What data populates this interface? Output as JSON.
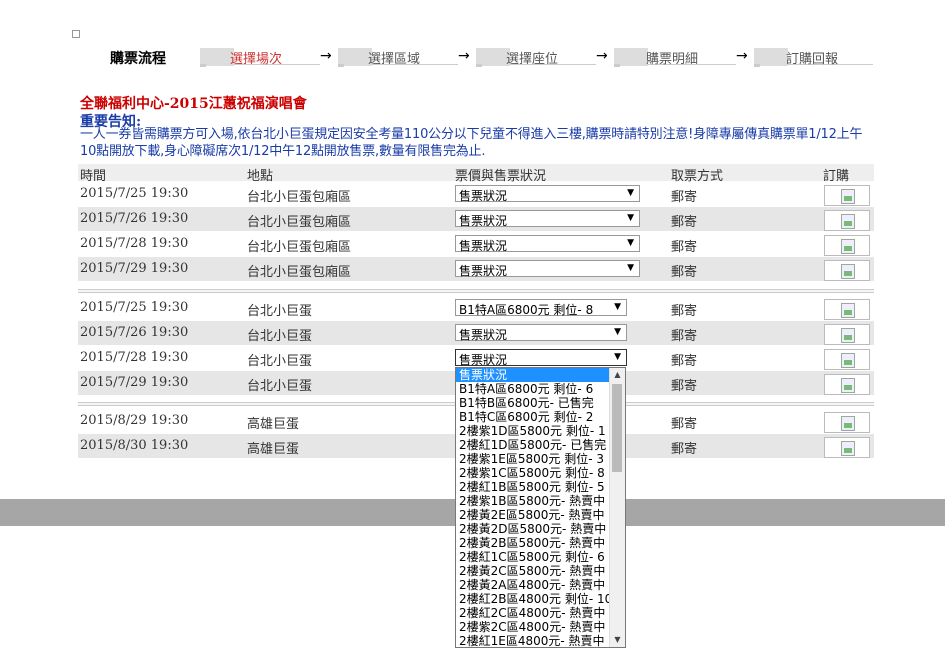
{
  "steps": {
    "title": "購票流程",
    "items": [
      {
        "label": "選擇場次"
      },
      {
        "label": "選擇區域"
      },
      {
        "label": "選擇座位"
      },
      {
        "label": "購票明細"
      },
      {
        "label": "訂購回報"
      }
    ],
    "arrow": "→"
  },
  "event_title": "全聯福利中心-2015江蕙祝福演唱會",
  "notice_heading": "重要告知:",
  "notice_text": "一人一券皆需購票方可入場,依台北小巨蛋規定因安全考量110公分以下兒童不得進入三樓,購票時請特別注意!身障專屬傳真購票單1/12上午10點開放下載,身心障礙席次1/12中午12點開放售票,數量有限售完為止.",
  "table": {
    "headers": [
      "時間",
      "地點",
      "票價與售票狀況",
      "取票方式",
      "訂購"
    ],
    "groups": [
      [
        {
          "time": "2015/7/25 19:30",
          "venue": "台北小巨蛋包廂區",
          "status": "售票狀況",
          "pickup": "郵寄"
        },
        {
          "time": "2015/7/26 19:30",
          "venue": "台北小巨蛋包廂區",
          "status": "售票狀況",
          "pickup": "郵寄"
        },
        {
          "time": "2015/7/28 19:30",
          "venue": "台北小巨蛋包廂區",
          "status": "售票狀況",
          "pickup": "郵寄"
        },
        {
          "time": "2015/7/29 19:30",
          "venue": "台北小巨蛋包廂區",
          "status": "售票狀況",
          "pickup": "郵寄"
        }
      ],
      [
        {
          "time": "2015/7/25 19:30",
          "venue": "台北小巨蛋",
          "status": "B1特A區6800元 剩位- 8",
          "pickup": "郵寄"
        },
        {
          "time": "2015/7/26 19:30",
          "venue": "台北小巨蛋",
          "status": "售票狀況",
          "pickup": "郵寄"
        },
        {
          "time": "2015/7/28 19:30",
          "venue": "台北小巨蛋",
          "status": "售票狀況",
          "pickup": "郵寄"
        },
        {
          "time": "2015/7/29 19:30",
          "venue": "台北小巨蛋",
          "status": "",
          "pickup": "郵寄"
        }
      ],
      [
        {
          "time": "2015/8/29 19:30",
          "venue": "高雄巨蛋",
          "status": "",
          "pickup": "郵寄"
        },
        {
          "time": "2015/8/30 19:30",
          "venue": "高雄巨蛋",
          "status": "",
          "pickup": "郵寄"
        }
      ]
    ]
  },
  "dropdown": {
    "options": [
      "售票狀況",
      "B1特A區6800元 剩位- 6",
      "B1特B區6800元- 已售完",
      "B1特C區6800元 剩位- 2",
      "2樓紫1D區5800元 剩位- 1",
      "2樓紅1D區5800元- 已售完",
      "2樓紫1E區5800元 剩位- 3",
      "2樓紫1C區5800元 剩位- 8",
      "2樓紅1B區5800元 剩位- 5",
      "2樓紫1B區5800元- 熱賣中",
      "2樓黃2E區5800元- 熱賣中",
      "2樓黃2D區5800元- 熱賣中",
      "2樓黃2B區5800元- 熱賣中",
      "2樓紅1C區5800元 剩位- 6",
      "2樓黃2C區5800元- 熱賣中",
      "2樓黃2A區4800元- 熱賣中",
      "2樓紅2B區4800元 剩位- 10",
      "2樓紅2C區4800元- 熱賣中",
      "2樓紫2C區4800元- 熱賣中",
      "2樓紅1E區4800元- 熱賣中"
    ]
  },
  "colors": {
    "event_title": "#cc0000",
    "notice": "#1a3ca8",
    "selected_option": "#1e90ff",
    "band": "#a6a6a6"
  }
}
